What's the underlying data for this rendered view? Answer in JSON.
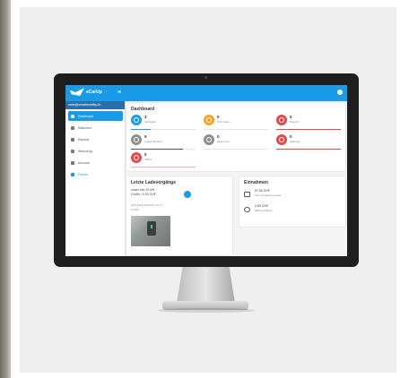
{
  "app": {
    "name": "eCarUp",
    "email": "mate@smartmobility.ch"
  },
  "sidebar": {
    "items": [
      {
        "label": "Dashboard",
        "icon": "speedometer-icon"
      },
      {
        "label": "Stationen",
        "icon": "charging-station-icon"
      },
      {
        "label": "Reports",
        "icon": "document-icon"
      },
      {
        "label": "Werkzeug",
        "icon": "wrench-icon"
      },
      {
        "label": "Account",
        "icon": "account-icon"
      },
      {
        "label": "Fahren",
        "icon": "car-icon"
      }
    ]
  },
  "dashboard": {
    "title": "Dashboard",
    "stats": [
      {
        "value": "3",
        "label": "Verfügbar",
        "color": "#1a9be8"
      },
      {
        "value": "0",
        "label": "Verbunden",
        "color": "#f5a623"
      },
      {
        "value": "0",
        "label": "Besetzt",
        "color": "#e5484d"
      },
      {
        "value": "5",
        "label": "Ausser Betrieb",
        "color": "#8e8e8e"
      },
      {
        "value": "0",
        "label": "Reserviert",
        "color": "#8e8e8e"
      },
      {
        "value": "0",
        "label": "Wartung",
        "color": "#e5484d"
      },
      {
        "value": "0",
        "label": "Offline",
        "color": "#e5484d"
      }
    ]
  },
  "recent": {
    "title": "Letzte Ladevorgänge",
    "line1": "smart mio 22 kW",
    "line2": "0 kWh / 0.00 CHF",
    "line3": "25.5.2018 00:00:00 / 4.1 h",
    "line4": "0 kWh"
  },
  "income": {
    "title": "Einnahmen",
    "rows": [
      {
        "amount": "57.00 CHF",
        "desc": "Zur Auszahlung bereit",
        "icon": "card-icon"
      },
      {
        "amount": "0.00 CHF",
        "desc": "Bald verfügbar",
        "icon": "clock-icon"
      }
    ]
  }
}
